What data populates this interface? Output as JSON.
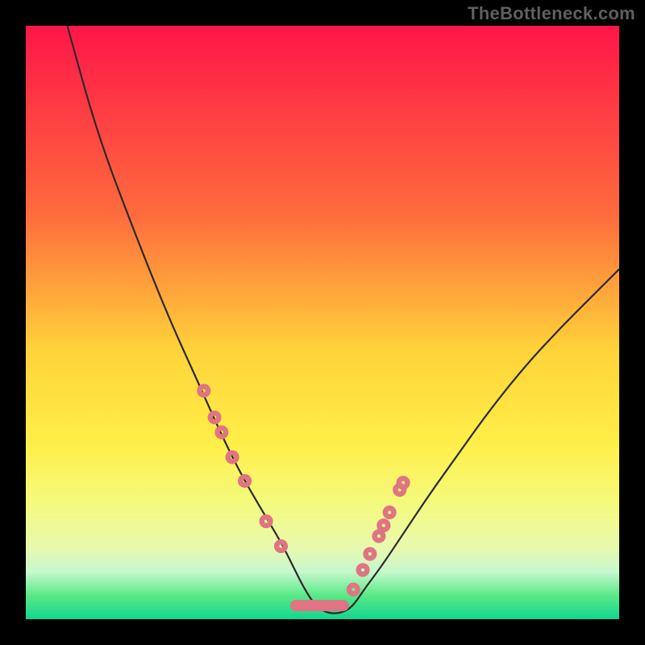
{
  "branding": {
    "watermark": "TheBottleneck.com"
  },
  "palette": {
    "top": "#ff1649",
    "mid": "#ffee47",
    "bottom": "#11d691",
    "curve": "#2a2a2a",
    "marker": "#e07483",
    "frame": "#000000"
  },
  "chart_data": {
    "type": "line",
    "title": "",
    "xlabel": "",
    "ylabel": "",
    "xlim": [
      0,
      100
    ],
    "ylim": [
      0,
      100
    ],
    "grid": false,
    "series": [
      {
        "name": "bottleneck-curve",
        "x": [
          7,
          12,
          18,
          24,
          29,
          33,
          36.5,
          40,
          43,
          45,
          47,
          49,
          51,
          53,
          55,
          57,
          60,
          64,
          68,
          73,
          78,
          84,
          90,
          96,
          100
        ],
        "y": [
          100,
          82,
          66,
          51,
          40,
          31,
          24,
          18,
          13,
          9,
          5,
          2,
          1,
          1,
          2,
          5,
          9,
          15,
          21,
          28,
          35,
          42.5,
          49,
          55,
          59
        ]
      }
    ],
    "markers": {
      "name": "highlighted-points",
      "x": [
        30.0,
        31.8,
        33.0,
        34.8,
        36.9,
        40.5,
        43.0,
        55.2,
        56.8,
        58.0,
        59.5,
        60.3,
        61.3,
        63.0,
        63.6
      ],
      "y": [
        38.5,
        34.0,
        31.5,
        27.3,
        23.3,
        16.5,
        12.3,
        5.0,
        8.3,
        11.0,
        14.0,
        15.8,
        18.0,
        21.8,
        23.0
      ]
    },
    "valley_segment": {
      "x_start": 45.5,
      "x_end": 53.5,
      "y": 2.3
    }
  }
}
